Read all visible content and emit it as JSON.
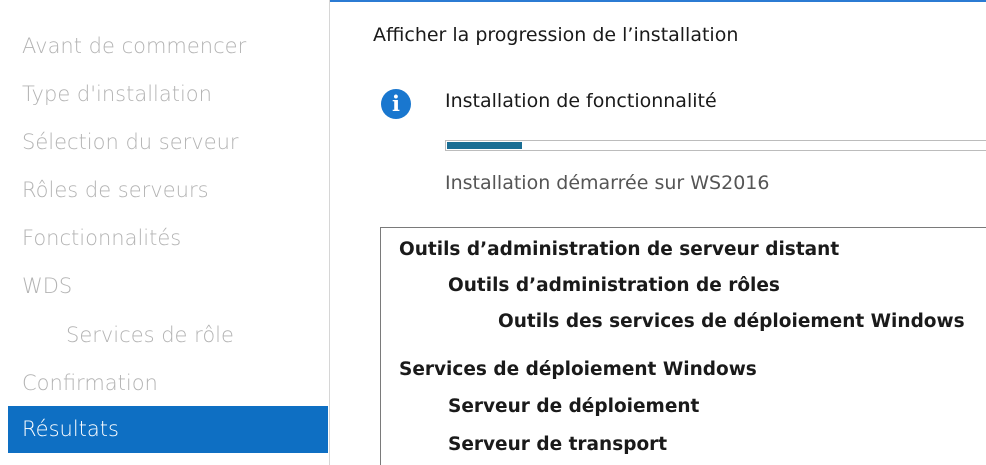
{
  "sidebar": {
    "items": [
      {
        "label": "Avant de commencer"
      },
      {
        "label": "Type d'installation"
      },
      {
        "label": "Sélection du serveur"
      },
      {
        "label": "Rôles de serveurs"
      },
      {
        "label": "Fonctionnalités"
      },
      {
        "label": "WDS"
      },
      {
        "label": "Services de rôle"
      },
      {
        "label": "Confirmation"
      },
      {
        "label": "Résultats"
      }
    ],
    "active": "Résultats"
  },
  "main": {
    "title": "Afficher la progression de l’installation",
    "status_icon": "info-icon",
    "status_title": "Installation de fonctionnalité",
    "progress": 0.14,
    "status_sub": "Installation démarrée sur WS2016",
    "results": [
      {
        "label": "Outils d’administration de serveur distant"
      },
      {
        "label": "Outils d’administration de rôles"
      },
      {
        "label": "Outils des services de déploiement Windows"
      },
      {
        "label": "Services de déploiement Windows"
      },
      {
        "label": "Serveur de déploiement"
      },
      {
        "label": "Serveur de transport"
      }
    ]
  },
  "colors": {
    "accent": "#0e6fc3",
    "progress": "#1a6e94",
    "info_icon": "#1977cf",
    "disabled_text": "#b3b3b3"
  }
}
